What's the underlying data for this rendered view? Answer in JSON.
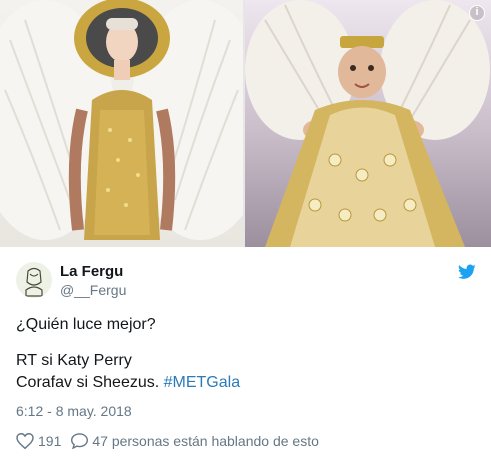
{
  "tweet": {
    "display_name": "La Fergu",
    "handle": "@__Fergu",
    "lines": [
      "¿Quién luce mejor?",
      "RT si Katy Perry",
      "Corafav si Sheezus. "
    ],
    "hashtag": "#METGala",
    "timestamp": "6:12 - 8 may. 2018",
    "likes": "191",
    "conversation": "47 personas están hablando de esto"
  },
  "media": {
    "left_image_desc": "",
    "right_image_desc": ""
  },
  "icons": {
    "info": "info-icon",
    "bird": "twitter-bird-icon",
    "heart": "heart-icon",
    "reply": "speech-bubble-icon"
  },
  "colors": {
    "accent": "#1da1f2",
    "hashtag": "#2b7bb9",
    "muted": "#657786",
    "text": "#14171a"
  }
}
